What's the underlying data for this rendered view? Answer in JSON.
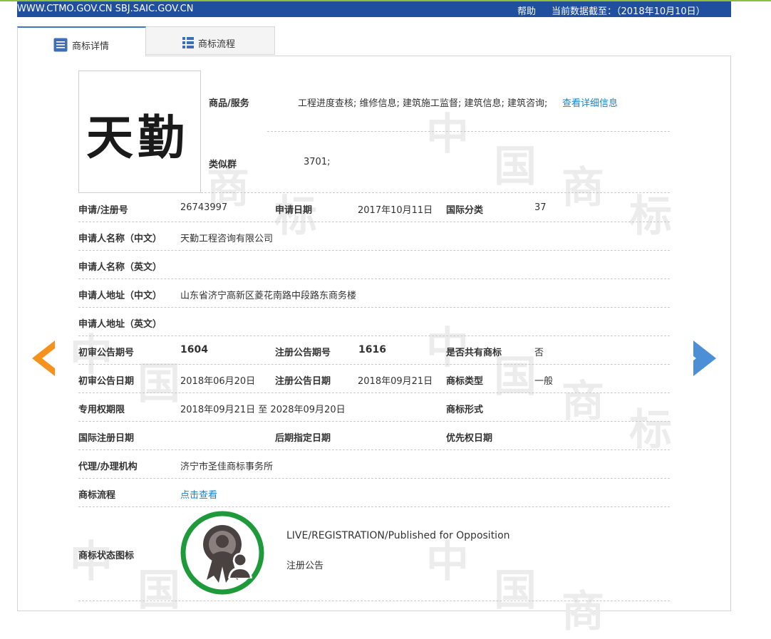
{
  "topbar": {
    "site": "WWW.CTMO.GOV.CN SBJ.SAIC.GOV.CN",
    "help": "帮助",
    "data_date": "当前数据截至：（2018年10月10日）"
  },
  "tabs": [
    {
      "label": "商标详情",
      "icon": "document-list-icon",
      "active": true
    },
    {
      "label": "商标流程",
      "icon": "list-grid-icon",
      "active": false
    }
  ],
  "watermark": [
    "中",
    "国",
    "商",
    "标"
  ],
  "logo": {
    "text": "天勤"
  },
  "goods": {
    "label": "商品/服务",
    "value": "工程进度查核; 维修信息; 建筑施工监督; 建筑信息; 建筑咨询;",
    "link": "查看详细信息"
  },
  "similar_group": {
    "label": "类似群",
    "value": "3701;"
  },
  "rows": {
    "reg_no_label": "申请/注册号",
    "reg_no": "26743997",
    "app_date_label": "申请日期",
    "app_date": "2017年10月11日",
    "intl_class_label": "国际分类",
    "intl_class": "37",
    "applicant_cn_label": "申请人名称（中文）",
    "applicant_cn": "天勤工程咨询有限公司",
    "applicant_en_label": "申请人名称（英文）",
    "applicant_en": "",
    "address_cn_label": "申请人地址（中文）",
    "address_cn": "山东省济宁高新区菱花南路中段路东商务楼",
    "address_en_label": "申请人地址（英文）",
    "address_en": "",
    "prelim_no_label": "初审公告期号",
    "prelim_no": "1604",
    "reg_pub_no_label": "注册公告期号",
    "reg_pub_no": "1616",
    "shared_label": "是否共有商标",
    "shared": "否",
    "prelim_date_label": "初审公告日期",
    "prelim_date": "2018年06月20日",
    "reg_pub_date_label": "注册公告日期",
    "reg_pub_date": "2018年09月21日",
    "tm_type_label": "商标类型",
    "tm_type": "一般",
    "exclusive_label": "专用权期限",
    "exclusive": "2018年09月21日 至 2028年09月20日",
    "tm_form_label": "商标形式",
    "tm_form": "",
    "intl_reg_date_label": "国际注册日期",
    "intl_reg_date": "",
    "later_date_label": "后期指定日期",
    "later_date": "",
    "priority_date_label": "优先权日期",
    "priority_date": "",
    "agent_label": "代理/办理机构",
    "agent": "济宁市圣佳商标事务所",
    "flow_label": "商标流程",
    "flow_link": "点击查看",
    "status_label": "商标状态图标",
    "status_en": "LIVE/REGISTRATION/Published for Opposition",
    "status_cn": "注册公告"
  },
  "colors": {
    "topbar": "#1f4f9e",
    "link": "#1b82c8",
    "arrow_prev": "#f5921e",
    "arrow_next": "#4d8fd6",
    "status_ring": "#1e9a3a"
  },
  "icons": {
    "prev": "arrow-left-icon",
    "next": "arrow-right-icon",
    "status": "award-ribbon-icon"
  }
}
